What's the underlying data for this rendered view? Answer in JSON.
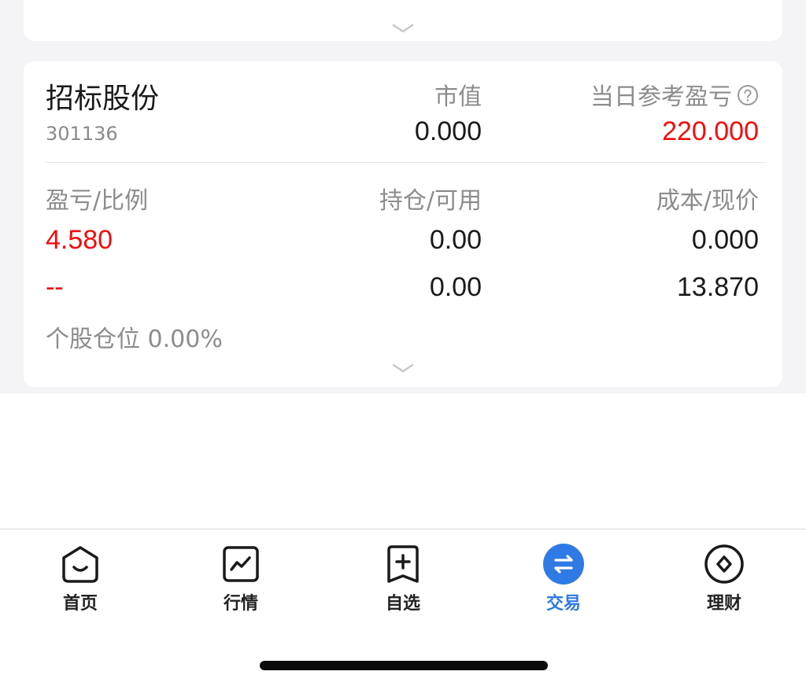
{
  "stock": {
    "name": "招标股份",
    "code": "301136",
    "market_value_label": "市值",
    "market_value": "0.000",
    "daily_pnl_label": "当日参考盈亏",
    "daily_pnl": "220.000",
    "pnl_ratio_label": "盈亏/比例",
    "pnl": "4.580",
    "ratio": "--",
    "holding_label": "持仓/可用",
    "holding": "0.00",
    "available": "0.00",
    "cost_label": "成本/现价",
    "cost": "0.000",
    "price": "13.870",
    "position_text": "个股仓位 0.00%"
  },
  "tabs": [
    {
      "label": "首页",
      "icon": "home-icon"
    },
    {
      "label": "行情",
      "icon": "chart-icon"
    },
    {
      "label": "自选",
      "icon": "watchlist-add-icon"
    },
    {
      "label": "交易",
      "icon": "trade-exchange-icon",
      "active": true
    },
    {
      "label": "理财",
      "icon": "wealth-icon"
    }
  ],
  "colors": {
    "red": "#f20d0d",
    "accent": "#2f7ae5",
    "muted": "#8c8c8c"
  }
}
